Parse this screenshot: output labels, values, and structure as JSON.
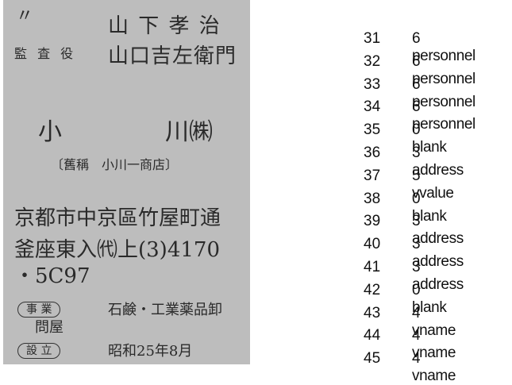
{
  "document_image": {
    "rows": [
      {
        "mark": "〃",
        "name": "山 下 孝 治"
      },
      {
        "role": "監 査 役",
        "name": "山口吉左衛門"
      }
    ],
    "company": {
      "name_left": "小",
      "name_right": "川㈱",
      "former_name": "〔舊稱　小川一商店〕"
    },
    "address_lines": [
      "京都市中京區竹屋町通",
      "釜座東入㈹上(3)4170",
      "・5C97"
    ],
    "business": {
      "tag": "事 業",
      "value": "石鹸・工業薬品卸",
      "continuation": "問屋"
    },
    "established": {
      "tag": "設 立",
      "value": "昭和25年8月"
    }
  },
  "line_labels": [
    {
      "index": "31",
      "label": "6 personnel"
    },
    {
      "index": "32",
      "label": "6 personnel"
    },
    {
      "index": "33",
      "label": "6 personnel"
    },
    {
      "index": "34",
      "label": "6 personnel"
    },
    {
      "index": "35",
      "label": "0 blank"
    },
    {
      "index": "36",
      "label": "3 address"
    },
    {
      "index": "37",
      "label": "5 vvalue"
    },
    {
      "index": "38",
      "label": "0 blank"
    },
    {
      "index": "39",
      "label": "3 address"
    },
    {
      "index": "40",
      "label": "3 address"
    },
    {
      "index": "41",
      "label": "3 address"
    },
    {
      "index": "42",
      "label": "0 blank"
    },
    {
      "index": "43",
      "label": "4 vname"
    },
    {
      "index": "44",
      "label": "4 vname"
    },
    {
      "index": "45",
      "label": "4 vname"
    }
  ]
}
